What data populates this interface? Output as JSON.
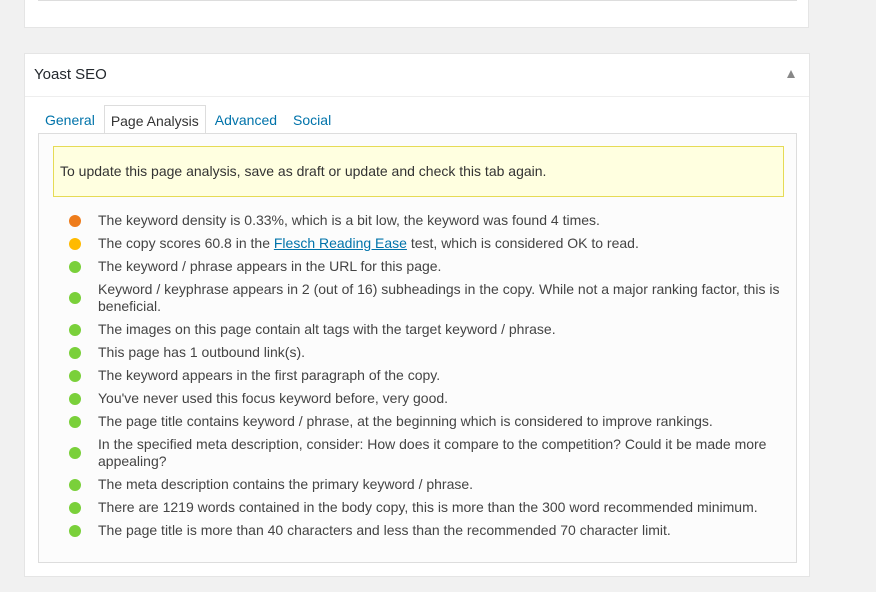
{
  "metabox": {
    "title": "Yoast SEO",
    "toggle_icon": "triangle-up-icon"
  },
  "tabs": [
    {
      "label": "General",
      "active": false
    },
    {
      "label": "Page Analysis",
      "active": true
    },
    {
      "label": "Advanced",
      "active": false
    },
    {
      "label": "Social",
      "active": false
    }
  ],
  "notice": "To update this page analysis, save as draft or update and check this tab again.",
  "colors": {
    "bad": "#ee7c1b",
    "ok": "#ffba00",
    "good": "#7ad03a",
    "link": "#0073aa"
  },
  "results": [
    {
      "status": "bad",
      "text": "The keyword density is 0.33%, which is a bit low, the keyword was found 4 times."
    },
    {
      "status": "ok",
      "before": "The copy scores 60.8 in the ",
      "link": "Flesch Reading Ease",
      "after": " test, which is considered OK to read."
    },
    {
      "status": "good",
      "text": "The keyword / phrase appears in the URL for this page."
    },
    {
      "status": "good",
      "text": "Keyword / keyphrase appears in 2 (out of 16) subheadings in the copy. While not a major ranking factor, this is beneficial."
    },
    {
      "status": "good",
      "text": "The images on this page contain alt tags with the target keyword / phrase."
    },
    {
      "status": "good",
      "text": "This page has 1 outbound link(s)."
    },
    {
      "status": "good",
      "text": "The keyword appears in the first paragraph of the copy."
    },
    {
      "status": "good",
      "text": "You've never used this focus keyword before, very good."
    },
    {
      "status": "good",
      "text": "The page title contains keyword / phrase, at the beginning which is considered to improve rankings."
    },
    {
      "status": "good",
      "text": "In the specified meta description, consider: How does it compare to the competition? Could it be made more appealing?"
    },
    {
      "status": "good",
      "text": "The meta description contains the primary keyword / phrase."
    },
    {
      "status": "good",
      "text": "There are 1219 words contained in the body copy, this is more than the 300 word recommended minimum."
    },
    {
      "status": "good",
      "text": "The page title is more than 40 characters and less than the recommended 70 character limit."
    }
  ]
}
